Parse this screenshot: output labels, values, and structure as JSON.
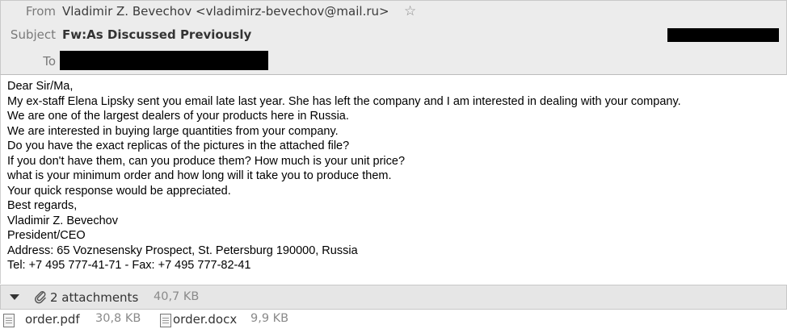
{
  "header": {
    "from_label": "From",
    "from_value": "Vladimir Z. Bevechov <vladimirz-bevechov@mail.ru>",
    "star_icon": "star-icon",
    "subject_label": "Subject",
    "subject_value": "Fw:As Discussed Previously",
    "to_label": "To"
  },
  "body_lines": [
    "Dear Sir/Ma,",
    "My ex-staff Elena Lipsky sent you email late last year. She has left the company and I am interested in dealing with your company.",
    "We are one of the largest dealers of your products here in Russia.",
    "We are interested in buying large quantities from your company.",
    "Do you have the exact replicas of the pictures in the attached file?",
    "If you don't have them, can you produce them? How much is your unit price?",
    "what is your minimum order and how long will it take you to produce them.",
    "Your quick response would be appreciated.",
    "Best regards,",
    "Vladimir Z. Bevechov",
    "President/CEO",
    "Address: 65 Voznesensky Prospect, St. Petersburg 190000, Russia",
    "Tel: +7 495 777-41-71  - Fax: +7 495 777-82-41"
  ],
  "attachments": {
    "count_label": "2 attachments",
    "total_size": "40,7 KB",
    "files": [
      {
        "name": "order.pdf",
        "size": "30,8 KB"
      },
      {
        "name": "order.docx",
        "size": "9,9 KB"
      }
    ]
  }
}
